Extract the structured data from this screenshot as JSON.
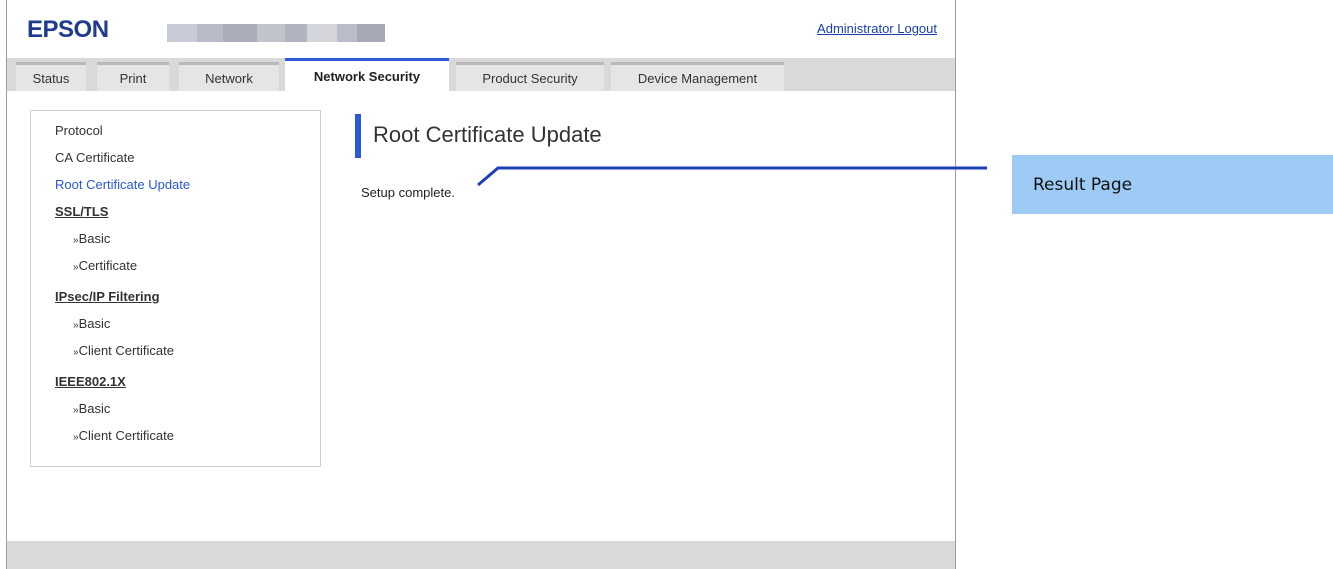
{
  "header": {
    "logo": "EPSON",
    "logout_link": "Administrator Logout"
  },
  "tabs": [
    {
      "label": "Status",
      "active": false
    },
    {
      "label": "Print",
      "active": false
    },
    {
      "label": "Network",
      "active": false
    },
    {
      "label": "Network Security",
      "active": true
    },
    {
      "label": "Product Security",
      "active": false
    },
    {
      "label": "Device Management",
      "active": false
    }
  ],
  "sidebar": {
    "protocol": "Protocol",
    "ca_certificate": "CA Certificate",
    "root_certificate_update": "Root Certificate Update",
    "ssl_tls": {
      "heading": "SSL/TLS",
      "basic": "Basic",
      "certificate": "Certificate"
    },
    "ipsec": {
      "heading": "IPsec/IP Filtering",
      "basic": "Basic",
      "client_certificate": "Client Certificate"
    },
    "ieee": {
      "heading": "IEEE802.1X",
      "basic": "Basic",
      "client_certificate": "Client Certificate"
    },
    "bullet": "»"
  },
  "main": {
    "title": "Root Certificate Update",
    "status": "Setup complete."
  },
  "annotation": {
    "label": "Result Page"
  },
  "colors": {
    "brand": "#1f3c8f",
    "accent": "#2a58d6",
    "callout": "#9ecbf5"
  }
}
